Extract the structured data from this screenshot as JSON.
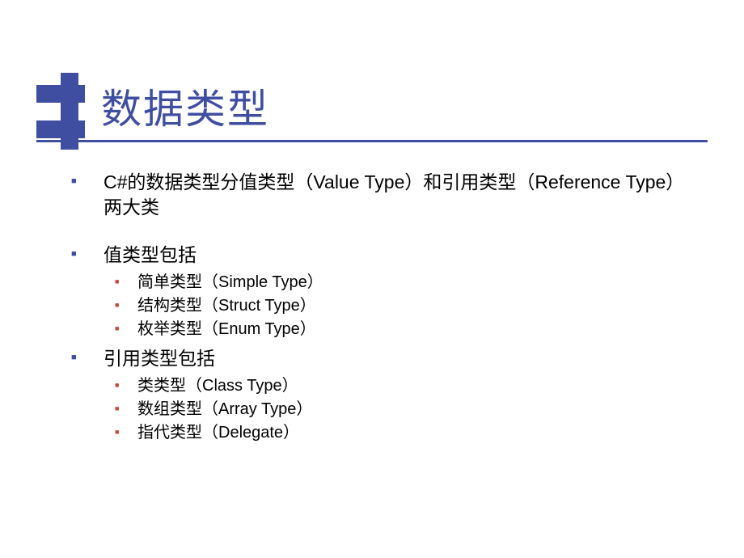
{
  "title": "数据类型",
  "bullets": [
    {
      "text": "C#的数据类型分值类型（Value Type）和引用类型（Reference Type）两大类",
      "children": []
    },
    {
      "text": "值类型包括",
      "children": [
        "简单类型（Simple Type）",
        "结构类型（Struct Type）",
        "枚举类型（Enum Type）"
      ]
    },
    {
      "text": "引用类型包括",
      "children": [
        "类类型（Class Type）",
        "数组类型（Array Type）",
        "指代类型（Delegate）"
      ]
    }
  ]
}
